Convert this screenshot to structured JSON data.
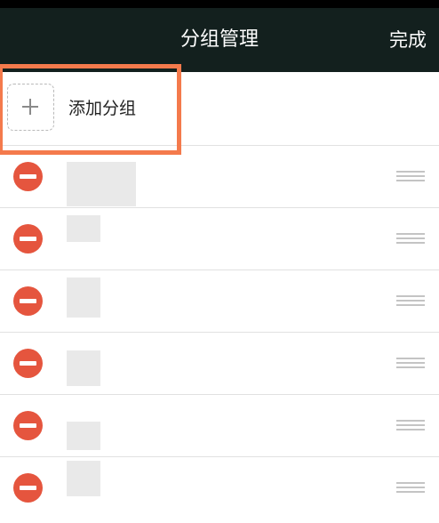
{
  "nav": {
    "title": "分组管理",
    "done_label": "完成"
  },
  "add_group": {
    "label": "添加分组",
    "plus_icon": "plus-icon"
  },
  "groups": [
    {
      "name": ""
    },
    {
      "name": ""
    },
    {
      "name": ""
    },
    {
      "name": ""
    },
    {
      "name": ""
    },
    {
      "name": ""
    }
  ],
  "colors": {
    "nav_background": "#13201e",
    "delete_red": "#e5553e",
    "highlight_orange": "#f47a4c",
    "divider": "#e1e1e1"
  }
}
